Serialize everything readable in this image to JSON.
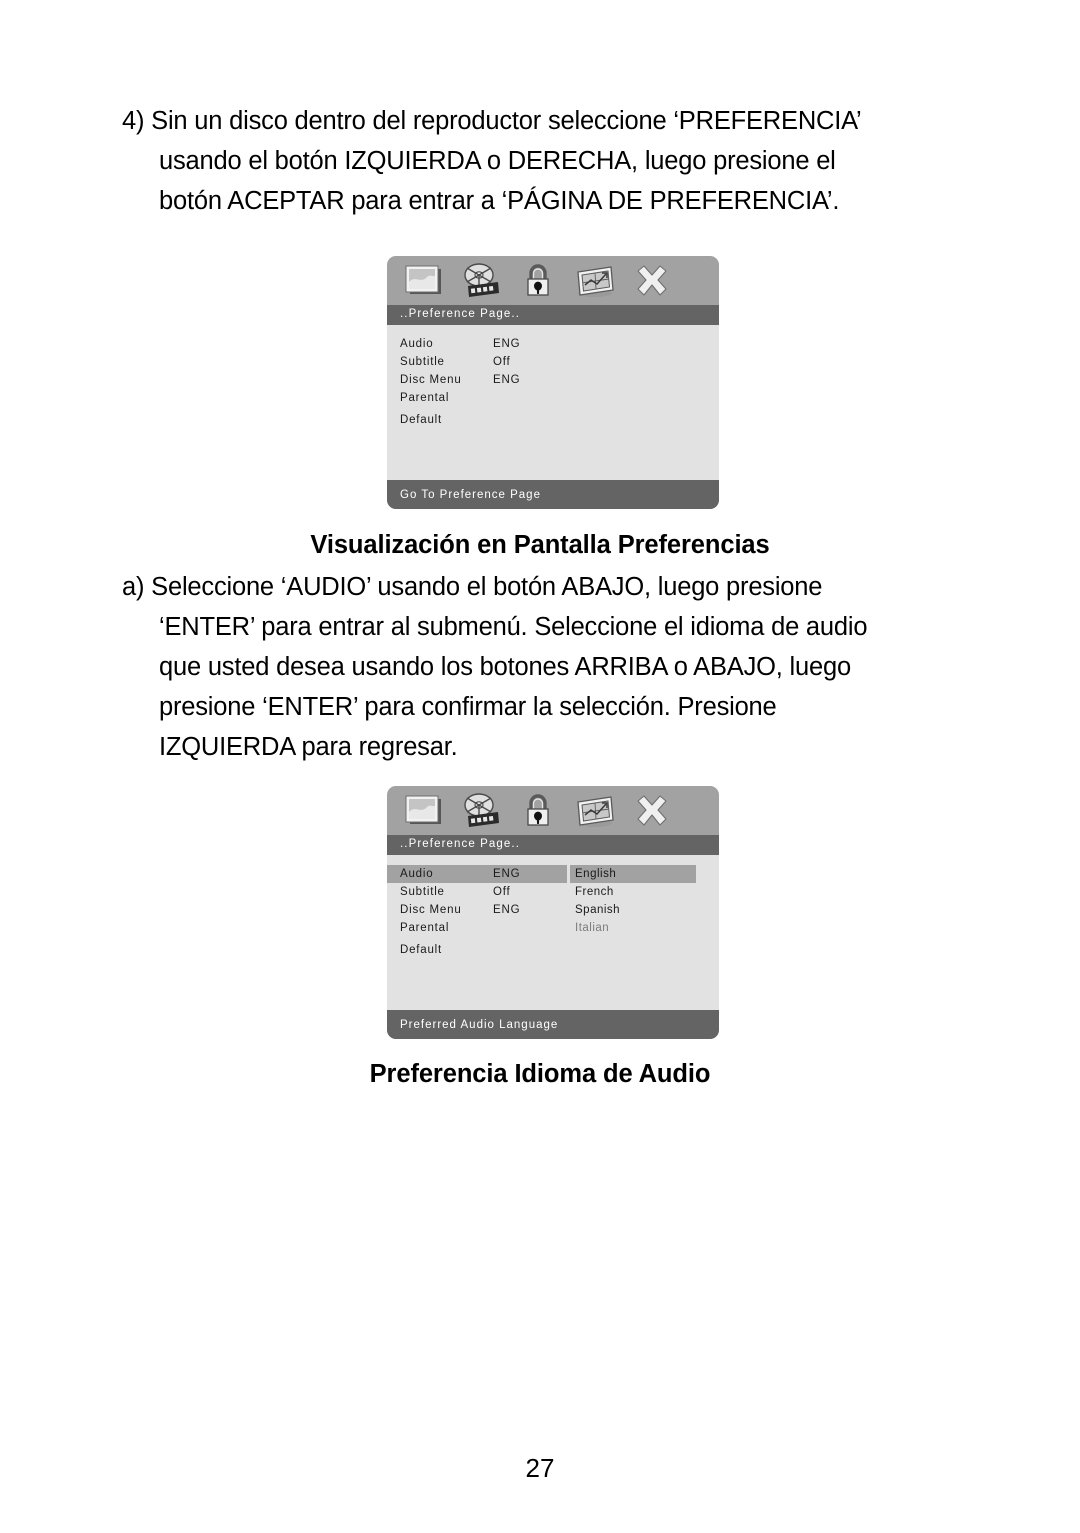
{
  "page": {
    "number": "27"
  },
  "step4": {
    "lines": [
      "4) Sin un disco dentro del reproductor seleccione ‘PREFERENCIA’",
      "usando el botón IZQUIERDA o DERECHA, luego presione el",
      "botón ACEPTAR para entrar a ‘PÁGINA DE PREFERENCIA’."
    ]
  },
  "headings": {
    "osd_preferences": "Visualización en Pantalla Preferencias",
    "audio_language": "Preferencia Idioma de Audio"
  },
  "stepa": {
    "lines": [
      "a) Seleccione ‘AUDIO’ usando el botón ABAJO, luego presione",
      "‘ENTER’ para entrar al submenú. Seleccione el idioma de audio",
      "que usted desea usando los botones ARRIBA o ABAJO, luego",
      "presione ‘ENTER’ para confirmar la selección. Presione",
      "IZQUIERDA para regresar."
    ]
  },
  "osd_icons": [
    "picture-frame-icon",
    "film-reel-icon",
    "padlock-icon",
    "preferences-chart-icon",
    "close-x-icon"
  ],
  "osd1": {
    "title": ". . P r e f e r e n c e   P a g e . .",
    "title_plain": "..Preference Page..",
    "rows": [
      {
        "label": "Audio",
        "value": "ENG",
        "selected": false
      },
      {
        "label": "Subtitle",
        "value": "Off",
        "selected": false
      },
      {
        "label": "Disc Menu",
        "value": "ENG",
        "selected": false
      },
      {
        "label": "Parental",
        "value": "",
        "selected": false
      },
      {
        "label": "Default",
        "value": "",
        "selected": false
      }
    ],
    "submenu": [],
    "status": "Go To Preference Page"
  },
  "osd2": {
    "title": "..Preference Page..",
    "rows": [
      {
        "label": "Audio",
        "value": "ENG",
        "selected": true
      },
      {
        "label": "Subtitle",
        "value": "Off",
        "selected": false
      },
      {
        "label": "Disc Menu",
        "value": "ENG",
        "selected": false
      },
      {
        "label": "Parental",
        "value": "",
        "selected": false
      },
      {
        "label": "Default",
        "value": "",
        "selected": false
      }
    ],
    "submenu": [
      {
        "label": "English",
        "selected": true,
        "dim": false
      },
      {
        "label": "French",
        "selected": false,
        "dim": false
      },
      {
        "label": "Spanish",
        "selected": false,
        "dim": false
      },
      {
        "label": "Italian",
        "selected": false,
        "dim": true
      }
    ],
    "status": "Preferred Audio Language"
  },
  "colors": {
    "panel_body": "#e2e2e2",
    "icon_bar": "#a2a2a2",
    "title_bar": "#646464",
    "highlight": "#a2a2a2",
    "text": "#1a1a1a",
    "dim_text": "#7d7d7d"
  }
}
